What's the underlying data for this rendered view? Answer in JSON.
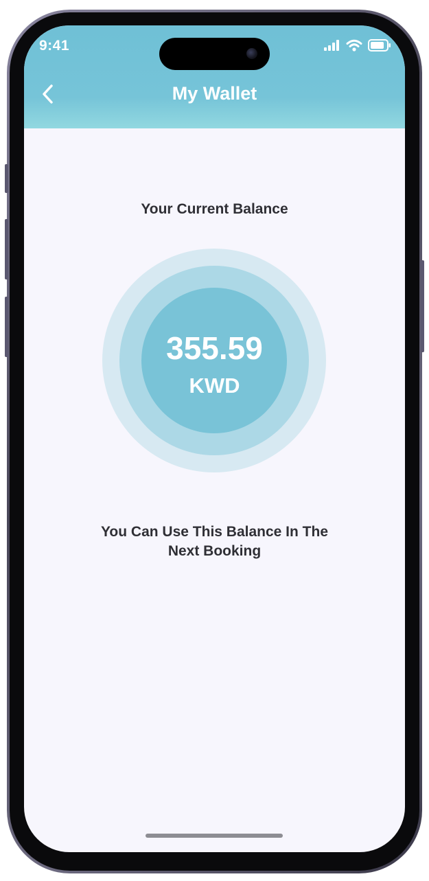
{
  "status_bar": {
    "time": "9:41",
    "icons": [
      "cellular-signal-icon",
      "wifi-icon",
      "battery-icon"
    ]
  },
  "header": {
    "title": "My Wallet",
    "back_icon": "chevron-left-icon"
  },
  "balance": {
    "label": "Your Current Balance",
    "amount": "355.59",
    "currency": "KWD"
  },
  "note": {
    "line1": "You Can Use This Balance In The",
    "line2": "Next Booking"
  },
  "colors": {
    "header_accent": "#76c4d8",
    "circle_outer": "#d7e9f2",
    "circle_middle": "#acd8e6",
    "circle_inner": "#79c3d7",
    "background": "#f7f6fd",
    "text_dark": "#2f2f35"
  }
}
